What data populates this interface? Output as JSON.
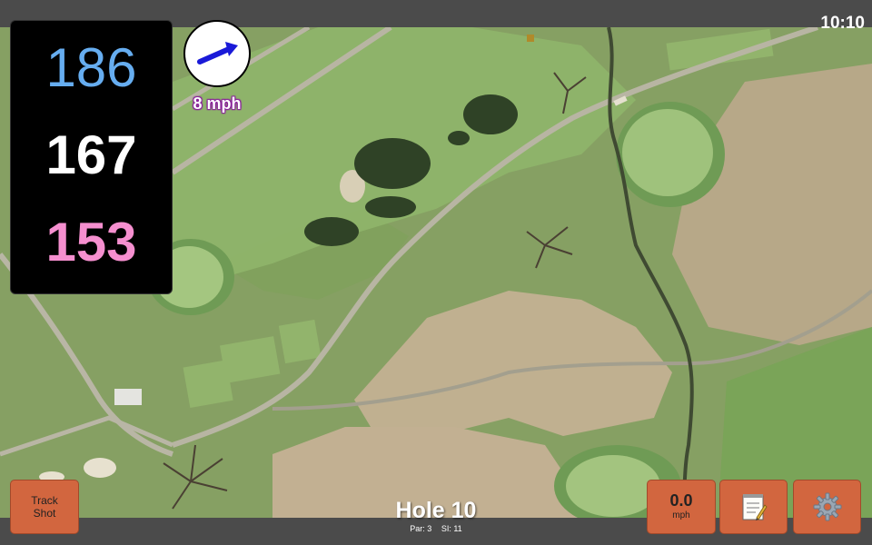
{
  "status": {
    "time": "10:10"
  },
  "distances": {
    "back": "186",
    "middle": "167",
    "front": "153"
  },
  "wind": {
    "speed_label": "8 mph",
    "direction_icon": "arrow-icon"
  },
  "hole": {
    "title": "Hole 10",
    "par_label": "Par: 3",
    "si_label": "SI: 11"
  },
  "buttons": {
    "track_shot_line1": "Track",
    "track_shot_line2": "Shot",
    "speed_value": "0.0",
    "speed_unit": "mph",
    "notes_icon": "notepad-icon",
    "settings_icon": "gear-icon"
  },
  "colors": {
    "back_distance": "#66adf0",
    "middle_distance": "#ffffff",
    "front_distance": "#f58fcf",
    "button": "#d2663f",
    "bar": "#4b4b4b"
  }
}
